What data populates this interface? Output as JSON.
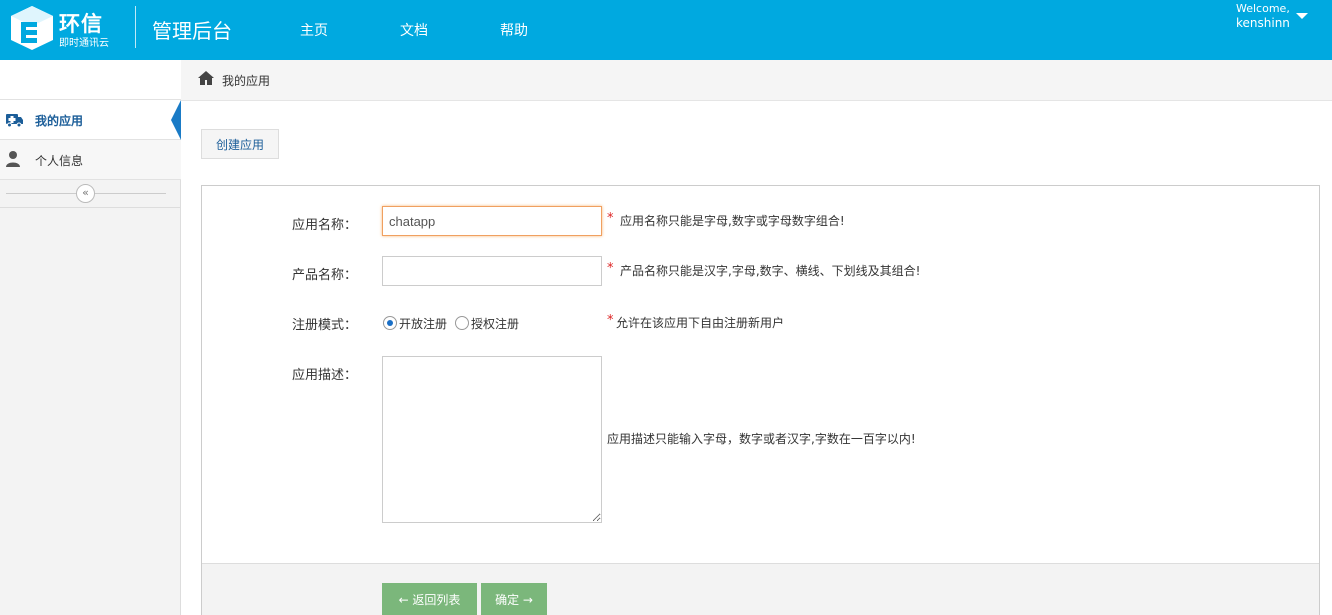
{
  "header": {
    "logo_name": "环信",
    "logo_sub": "即时通讯云",
    "title": "管理后台",
    "nav": [
      "主页",
      "文档",
      "帮助"
    ],
    "welcome": "Welcome,",
    "username": "kenshinn"
  },
  "sidebar": {
    "items": [
      {
        "label": "我的应用",
        "icon": "ambulance-icon",
        "active": true
      },
      {
        "label": "个人信息",
        "icon": "user-icon",
        "active": false
      }
    ],
    "collapse_glyph": "«"
  },
  "breadcrumb": {
    "icon": "home-icon",
    "text": "我的应用"
  },
  "create_button": "创建应用",
  "form": {
    "app_name": {
      "label": "应用名称：",
      "value": "chatapp",
      "hint": "应用名称只能是字母,数字或字母数字组合!"
    },
    "product_name": {
      "label": "产品名称：",
      "value": "",
      "hint": "产品名称只能是汉字,字母,数字、横线、下划线及其组合!"
    },
    "register_mode": {
      "label": "注册模式：",
      "options": [
        "开放注册",
        "授权注册"
      ],
      "selected": "开放注册",
      "hint": "允许在该应用下自由注册新用户"
    },
    "description": {
      "label": "应用描述：",
      "value": "",
      "hint": "应用描述只能输入字母，数字或者汉字,字数在一百字以内!"
    },
    "required_mark": "*",
    "back_button": "← 返回列表",
    "ok_button": "确定 →"
  },
  "colors": {
    "header": "#00a9e0",
    "accent": "#1a7bc6",
    "button_green": "#7bb77b",
    "required": "#dd2222"
  }
}
